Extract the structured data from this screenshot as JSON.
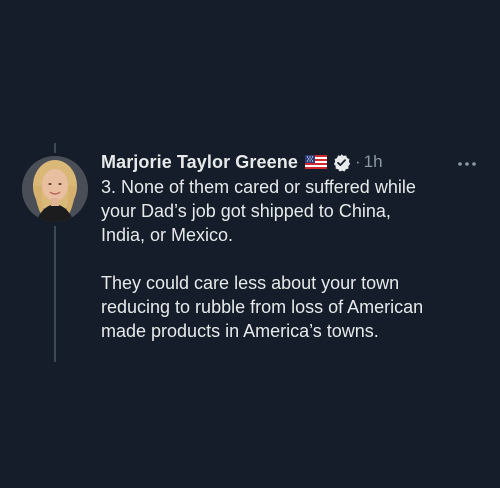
{
  "tweet": {
    "author": {
      "display_name": "Marjorie Taylor Greene",
      "flag_emoji": "us-flag-icon",
      "verified": true
    },
    "separator": "·",
    "timestamp": "1h",
    "text_lines": [
      "3. None of them cared or suffered while",
      "your Dad’s job got shipped to China,",
      "India, or Mexico."
    ],
    "text_lines_2": [
      "They could care less about your town",
      "reducing to rubble from loss of American",
      "made products in America’s towns."
    ]
  },
  "colors": {
    "background": "#141d29",
    "text_primary": "#e7e9ea",
    "text_secondary": "#8b98a5",
    "thread_line": "#3b4856"
  },
  "icons": {
    "more": "more-horizontal-icon",
    "verified": "verified-badge-icon",
    "flag": "us-flag-icon"
  }
}
